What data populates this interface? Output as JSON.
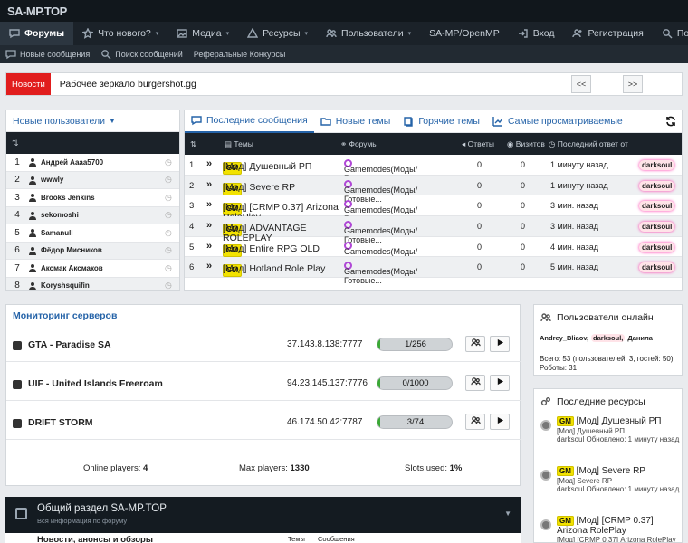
{
  "logo": "SA-MP.TOP",
  "nav": {
    "items": [
      {
        "label": "Форумы",
        "icon": "chat-icon",
        "active": true
      },
      {
        "label": "Что нового?",
        "icon": "star-icon",
        "caret": "▾"
      },
      {
        "label": "Медиа",
        "icon": "image-icon",
        "caret": "▾"
      },
      {
        "label": "Ресурсы",
        "icon": "resource-icon",
        "caret": "▾"
      },
      {
        "label": "Пользователи",
        "icon": "users-icon",
        "caret": "▾"
      },
      {
        "label": "SA-MP/OpenMP"
      }
    ],
    "login": "Вход",
    "register": "Регистрация",
    "search": "Поиск"
  },
  "subnav": [
    "Новые сообщения",
    "Поиск сообщений",
    "Реферальные Конкурсы"
  ],
  "news": {
    "tag": "Новости",
    "text": "Рабочее зеркало burgershot.gg",
    "prev": "<<",
    "next": ">>"
  },
  "new_users": {
    "title": "Новые пользователи",
    "sort_icon": "⇅",
    "rows": [
      {
        "n": "1",
        "name": "Андрей Aaaa5700"
      },
      {
        "n": "2",
        "name": "wwwly"
      },
      {
        "n": "3",
        "name": "Brooks Jenkins"
      },
      {
        "n": "4",
        "name": "sekomoshi"
      },
      {
        "n": "5",
        "name": "Samanull"
      },
      {
        "n": "6",
        "name": "Фёдор Мисников"
      },
      {
        "n": "7",
        "name": "Аксмак Аксмаков"
      },
      {
        "n": "8",
        "name": "Koryshsquifin"
      }
    ]
  },
  "messages": {
    "tabs": [
      "Последние сообщения",
      "Новые темы",
      "Горячие темы",
      "Самые просматриваемые"
    ],
    "columns": {
      "sort": "⇅",
      "topics": "Темы",
      "forums": "Форумы",
      "answers": "Ответы",
      "visits": "Визитов",
      "last": "Последний ответ от"
    },
    "rows": [
      {
        "n": "1",
        "tag": "GM",
        "title": "[Мод] Душевный РП",
        "forum": "Gamemodes(Моды/Готовые...",
        "answers": "0",
        "visits": "0",
        "last": "1 минуту назад",
        "author": "darksoul"
      },
      {
        "n": "2",
        "tag": "GM",
        "title": "[Мод] Severe RP",
        "forum": "Gamemodes(Моды/Готовые...",
        "answers": "0",
        "visits": "0",
        "last": "1 минуту назад",
        "author": "darksoul"
      },
      {
        "n": "3",
        "tag": "GM",
        "title": "[Мод] [CRMP 0.37] Arizona RolePlay",
        "forum": "Gamemodes(Моды/Готовые...",
        "answers": "0",
        "visits": "0",
        "last": "3 мин. назад",
        "author": "darksoul"
      },
      {
        "n": "4",
        "tag": "GM",
        "title": "[Мод] ADVANTAGE ROLEPLAY",
        "forum": "Gamemodes(Моды/Готовые...",
        "answers": "0",
        "visits": "0",
        "last": "3 мин. назад",
        "author": "darksoul"
      },
      {
        "n": "5",
        "tag": "GM",
        "title": "[Мод] Entire RPG OLD",
        "forum": "Gamemodes(Моды/Готовые...",
        "answers": "0",
        "visits": "0",
        "last": "4 мин. назад",
        "author": "darksoul"
      },
      {
        "n": "6",
        "tag": "GM",
        "title": "[Мод] Hotland Role Play",
        "forum": "Gamemodes(Моды/Готовые...",
        "answers": "0",
        "visits": "0",
        "last": "5 мин. назад",
        "author": "darksoul"
      }
    ]
  },
  "monitoring": {
    "title": "Мониторинг серверов",
    "servers": [
      {
        "name": "GTA - Paradise SA",
        "ip": "37.143.8.138:7777",
        "players": "1/256",
        "fill": 0.004
      },
      {
        "name": "UIF - United Islands Freeroam",
        "ip": "94.23.145.137:7776",
        "players": "0/1000",
        "fill": 0.0
      },
      {
        "name": "DRIFT STORM",
        "ip": "46.174.50.42:7787",
        "players": "3/74",
        "fill": 0.04
      }
    ],
    "online_label": "Online players:",
    "online_value": "4",
    "max_label": "Max players:",
    "max_value": "1330",
    "slots_label": "Slots used:",
    "slots_value": "1%"
  },
  "online": {
    "title": "Пользователи онлайн",
    "names": [
      "Andrey_Bliaov,",
      "darksoul,",
      "Данила"
    ],
    "stats_line1": "Всего: 53 (пользователей: 3, гостей: 50)",
    "stats_line2": "Роботы: 31"
  },
  "resources": {
    "title": "Последние ресурсы",
    "items": [
      {
        "tag": "GM",
        "title": "[Мод] Душевный РП",
        "sub": "[Мод] Душевный РП",
        "author": "darksoul",
        "updated": "Обновлено: 1 минуту назад"
      },
      {
        "tag": "GM",
        "title": "[Мод] Severe RP",
        "sub": "[Мод] Severe RP",
        "author": "darksoul",
        "updated": "Обновлено: 1 минуту назад"
      },
      {
        "tag": "GM",
        "title": "[Мод] [CRMP 0.37] Arizona RolePlay",
        "sub": "[Мод] [CRMP 0.37] Arizona RolePlay",
        "author": "",
        "updated": ""
      }
    ]
  },
  "forum_section": {
    "title": "Общий раздел SA-MP.TOP",
    "subtitle": "Вся информация по форуму",
    "row_title": "Новости, анонсы и обзоры",
    "col1": "Темы",
    "col2": "Сообщения"
  }
}
